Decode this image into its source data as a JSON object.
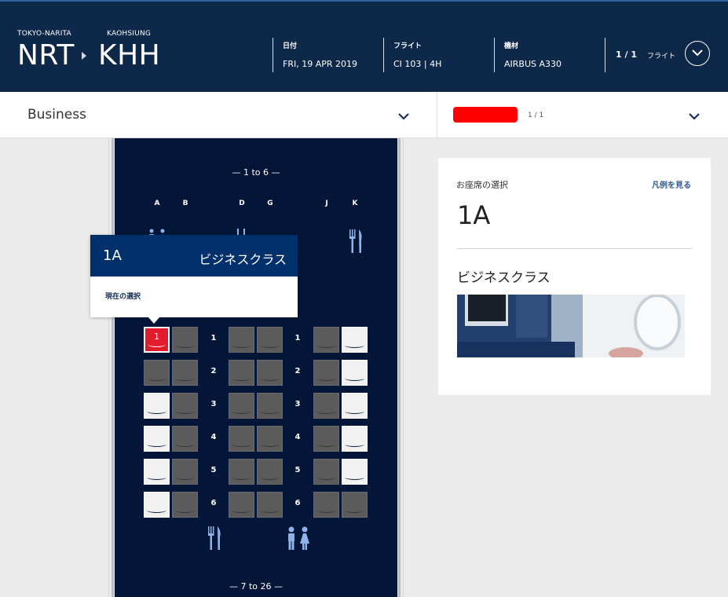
{
  "header": {
    "origin_city": "TOKYO-NARITA",
    "origin_code": "NRT",
    "dest_city": "KAOHSIUNG",
    "dest_code": "KHH",
    "date_label": "日付",
    "date_value": "FRI, 19 APR 2019",
    "flight_label": "フライト",
    "flight_value": "CI 103 | 4H",
    "aircraft_label": "機材",
    "aircraft_value": "AIRBUS A330",
    "pager_count": "1 / 1",
    "pager_label": "フライト"
  },
  "cabin_select": {
    "label": "Business"
  },
  "passenger_select": {
    "count": "1 / 1"
  },
  "seatmap": {
    "section_top": "— 1 to 6 —",
    "section_bottom": "— 7 to 26 —",
    "columns": [
      "A",
      "B",
      "D",
      "G",
      "J",
      "K"
    ],
    "rows": [
      "1",
      "2",
      "3",
      "4",
      "5",
      "6"
    ],
    "selected_seat_label": "1",
    "seats": {
      "1": [
        "selected",
        "occupied",
        "occupied",
        "occupied",
        "occupied",
        "available"
      ],
      "2": [
        "occupied",
        "occupied",
        "occupied",
        "occupied",
        "occupied",
        "available"
      ],
      "3": [
        "available",
        "occupied",
        "occupied",
        "occupied",
        "occupied",
        "available"
      ],
      "4": [
        "available",
        "occupied",
        "occupied",
        "occupied",
        "occupied",
        "available"
      ],
      "5": [
        "available",
        "occupied",
        "occupied",
        "occupied",
        "occupied",
        "available"
      ],
      "6": [
        "available",
        "occupied",
        "occupied",
        "occupied",
        "occupied",
        "occupied"
      ]
    }
  },
  "tooltip": {
    "seat": "1A",
    "cabin_class": "ビジネスクラス",
    "status": "現在の選択"
  },
  "panel": {
    "title": "お座席の選択",
    "legend_link": "凡例を見る",
    "seat": "1A",
    "cabin_class": "ビジネスクラス"
  },
  "colors": {
    "header_bg": "#0e2849",
    "cabin_bg": "#041638",
    "selected_seat": "#e21b2d",
    "occupied_seat": "#5b5b5b",
    "available_seat": "#f1f1f1",
    "tooltip_head": "#02306a",
    "link": "#2f5a95"
  }
}
